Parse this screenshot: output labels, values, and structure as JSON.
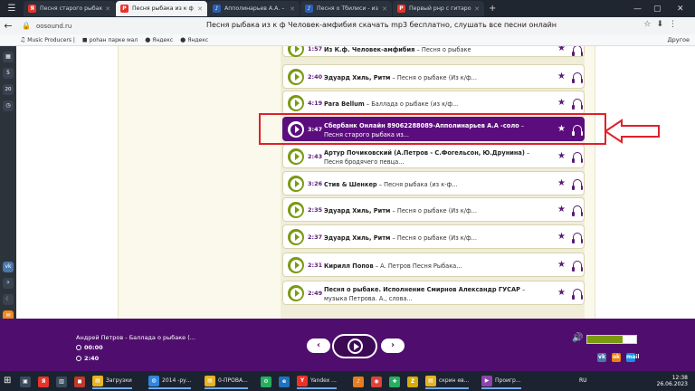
{
  "browser": {
    "tabs": [
      {
        "label": "Песня старого рыбака (Ч",
        "favicon": "Я",
        "favicon_color": "#e8332a",
        "active": false
      },
      {
        "label": "Песня рыбака из к ф Чел",
        "favicon": "P",
        "favicon_color": "#e8332a",
        "active": true
      },
      {
        "label": "Апполинарьев А.А. – Песн",
        "favicon": "♪",
        "favicon_color": "#2b5fb3",
        "active": false
      },
      {
        "label": "Песня о Тбилиси - из репе",
        "favicon": "♪",
        "favicon_color": "#2b5fb3",
        "active": false
      },
      {
        "label": "Первый рнр с гитарой UN",
        "favicon": "P",
        "favicon_color": "#e8332a",
        "active": false
      }
    ],
    "address": "oosound.ru",
    "page_title": "Песня рыбака из к ф Человек-амфибия скачать mp3 бесплатно, слушать все песни онлайн",
    "bookmarks": [
      {
        "label": "Music Producers |",
        "icon": "♫"
      },
      {
        "label": "роһан парке мал",
        "icon": "◼"
      },
      {
        "label": "Яндекс",
        "icon": "●"
      },
      {
        "label": "Яндекс",
        "icon": "●"
      }
    ],
    "other_bookmarks": "Другое",
    "sidebar_counters": [
      "5",
      "20"
    ]
  },
  "songs": [
    {
      "duration": "1:57",
      "artist": "Из К.ф. Человек-амфибия",
      "title": "Песня о рыбаке",
      "two_line": false,
      "active": false
    },
    {
      "duration": "2:40",
      "artist": "Эдуард Хиль, Ритм",
      "title": "Песня о рыбаке (Из к/ф...",
      "two_line": false,
      "active": false
    },
    {
      "duration": "4:19",
      "artist": "Para Bellum",
      "title": "Баллада о рыбаке (из к/ф...",
      "two_line": false,
      "active": false
    },
    {
      "duration": "3:47",
      "artist": "Сбербанк Онлайн 89062288089-Апполинарьев А.А -соло",
      "title": "Песня старого рыбака из...",
      "two_line": true,
      "active": true
    },
    {
      "duration": "2:43",
      "artist": "Артур Почиковский (А.Петров - С.Фогельсон, Ю.Друнина)",
      "title": "Песня бродячего певца...",
      "two_line": true,
      "active": false
    },
    {
      "duration": "3:26",
      "artist": "Стив & Шенкер",
      "title": "Песня рыбака (из к-ф...",
      "two_line": false,
      "active": false
    },
    {
      "duration": "2:35",
      "artist": "Эдуард Хиль, Ритм",
      "title": "Песня о рыбаке (Из к/ф...",
      "two_line": false,
      "active": false
    },
    {
      "duration": "2:37",
      "artist": "Эдуард Хиль, Ритм",
      "title": "Песня о рыбаке (Из к/ф...",
      "two_line": false,
      "active": false
    },
    {
      "duration": "2:31",
      "artist": "Кирилл Попов",
      "title": "А. Петров Песня Рыбака...",
      "two_line": false,
      "active": false
    },
    {
      "duration": "2:49",
      "artist": "Песня о рыбаке. Исполнение Смирнов Александр ГУСАР",
      "title": "музыка Петрова. А., слова...",
      "two_line": true,
      "active": false
    }
  ],
  "player": {
    "now_playing": "Андрей Петров - Баллада о рыбаке (...",
    "elapsed": "00:00",
    "total": "2:40",
    "volume_fraction": 0.72,
    "accent": "#4f0e6d",
    "share": [
      {
        "label": "vk",
        "color": "#4a76a8"
      },
      {
        "label": "ok",
        "color": "#ee8208"
      },
      {
        "label": "mail",
        "color": "#168de2"
      }
    ]
  },
  "taskbar": {
    "items": [
      {
        "label": "",
        "icon": "▣",
        "color": "#3a4a5c"
      },
      {
        "label": "",
        "icon": "Я",
        "color": "#e8332a"
      },
      {
        "label": "",
        "icon": "▥",
        "color": "#3a4a5c"
      },
      {
        "label": "",
        "icon": "◼",
        "color": "#c0392b"
      },
      {
        "label": "Загрузки",
        "icon": "▤",
        "color": "#e6b422"
      },
      {
        "label": "2014 -ру...",
        "icon": "◍",
        "color": "#2e86de"
      },
      {
        "label": "0-ПРОВА...",
        "icon": "▤",
        "color": "#e6b422"
      },
      {
        "label": "",
        "icon": "⚙",
        "color": "#27ae60"
      },
      {
        "label": "",
        "icon": "e",
        "color": "#1e73be"
      },
      {
        "label": "Yandex ...",
        "icon": "Y",
        "color": "#e8332a"
      },
      {
        "label": "",
        "icon": "♪",
        "color": "#e67e22"
      },
      {
        "label": "",
        "icon": "◉",
        "color": "#db4437"
      },
      {
        "label": "",
        "icon": "✚",
        "color": "#27ae60"
      },
      {
        "label": "",
        "icon": "Z",
        "color": "#d4ac0d"
      },
      {
        "label": "скрин ев...",
        "icon": "▤",
        "color": "#e6b422"
      },
      {
        "label": "Проигр...",
        "icon": "▶",
        "color": "#8e44ad"
      }
    ],
    "language": "RU",
    "clock_time": "12:38",
    "clock_date": "26.06.2023"
  }
}
